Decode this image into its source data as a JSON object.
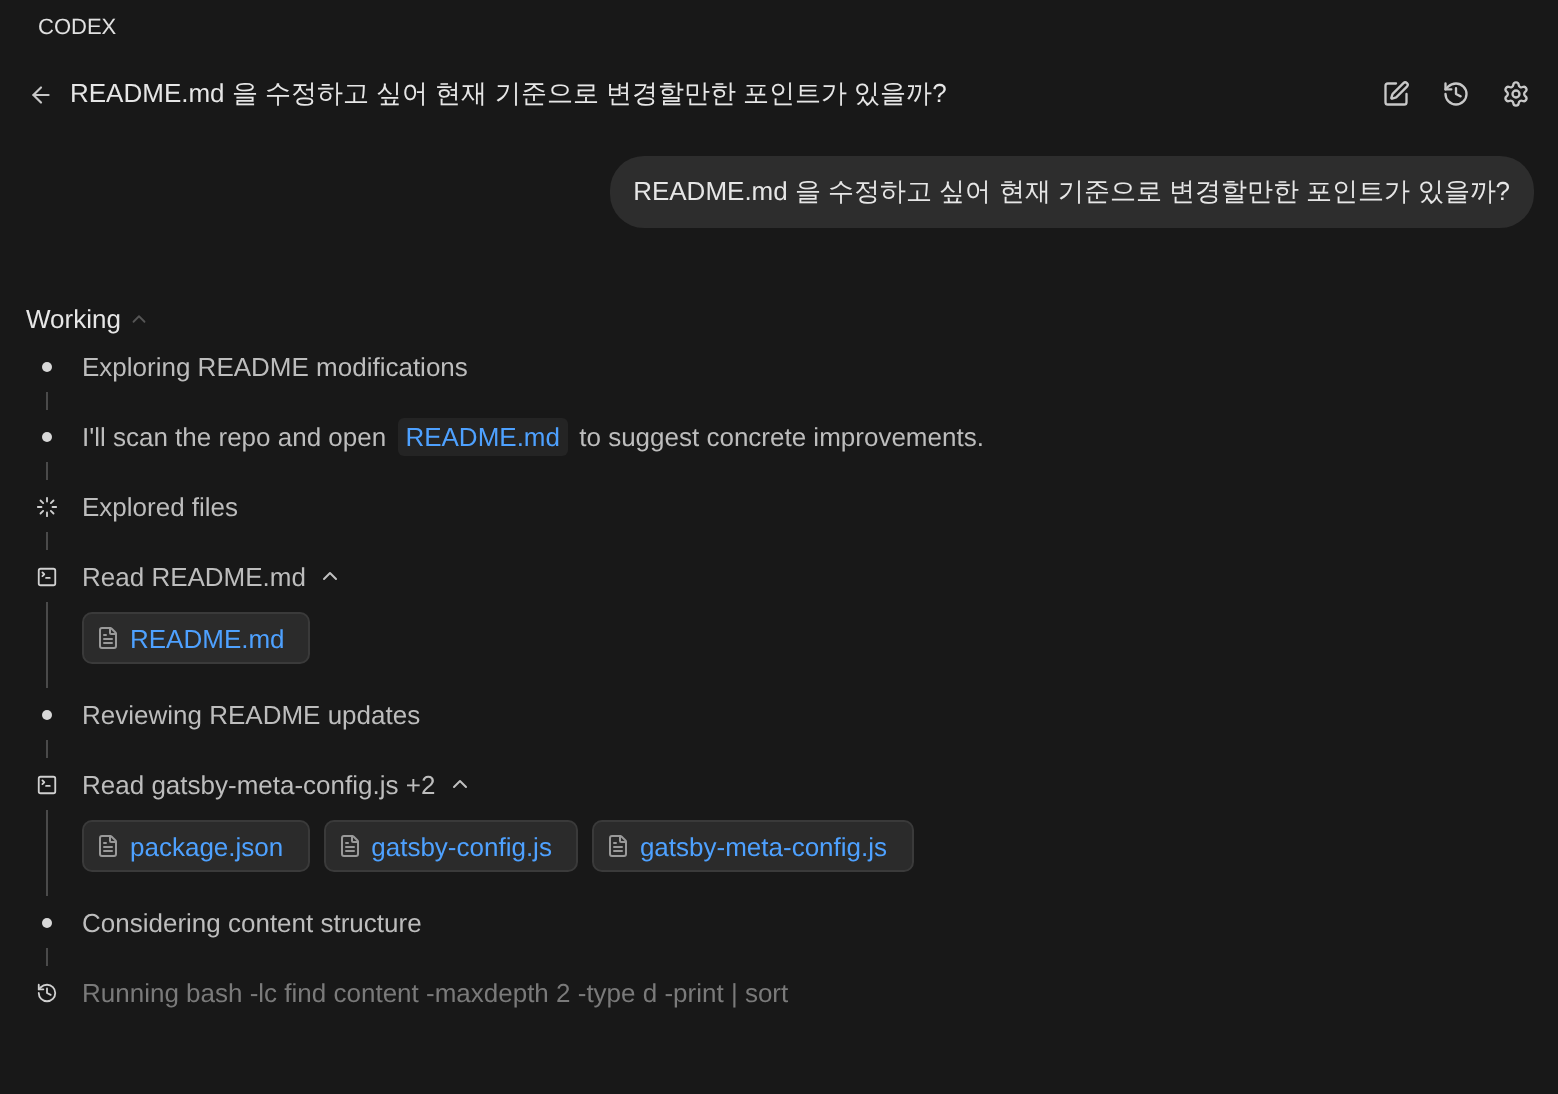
{
  "app_label": "CODEX",
  "header": {
    "title": "README.md 을 수정하고 싶어 현재 기준으로 변경할만한 포인트가 있을까?"
  },
  "user_message": "README.md 을 수정하고 싶어 현재 기준으로 변경할만한 포인트가 있을까?",
  "status": {
    "label": "Working",
    "expanded": true
  },
  "steps": [
    {
      "kind": "bullet",
      "parts": [
        {
          "kind": "text",
          "text": "Exploring README modifications"
        }
      ]
    },
    {
      "kind": "bullet",
      "parts": [
        {
          "kind": "text",
          "text": "I'll scan the repo and open "
        },
        {
          "kind": "code",
          "text": "README.md"
        },
        {
          "kind": "text",
          "text": " to suggest concrete improvements."
        }
      ]
    },
    {
      "kind": "explored",
      "parts": [
        {
          "kind": "text",
          "text": "Explored files"
        }
      ]
    },
    {
      "kind": "read",
      "parts": [
        {
          "kind": "text",
          "text": "Read README.md"
        }
      ],
      "expanded": true,
      "files": [
        "README.md"
      ]
    },
    {
      "kind": "bullet",
      "parts": [
        {
          "kind": "text",
          "text": "Reviewing README updates"
        }
      ]
    },
    {
      "kind": "read",
      "parts": [
        {
          "kind": "text",
          "text": "Read gatsby-meta-config.js +2"
        }
      ],
      "expanded": true,
      "files": [
        "package.json",
        "gatsby-config.js",
        "gatsby-meta-config.js"
      ]
    },
    {
      "kind": "bullet",
      "parts": [
        {
          "kind": "text",
          "text": "Considering content structure"
        }
      ]
    },
    {
      "kind": "running",
      "parts": [
        {
          "kind": "text",
          "text": "Running bash -lc find content -maxdepth 2 -type d -print | sort"
        }
      ]
    }
  ]
}
